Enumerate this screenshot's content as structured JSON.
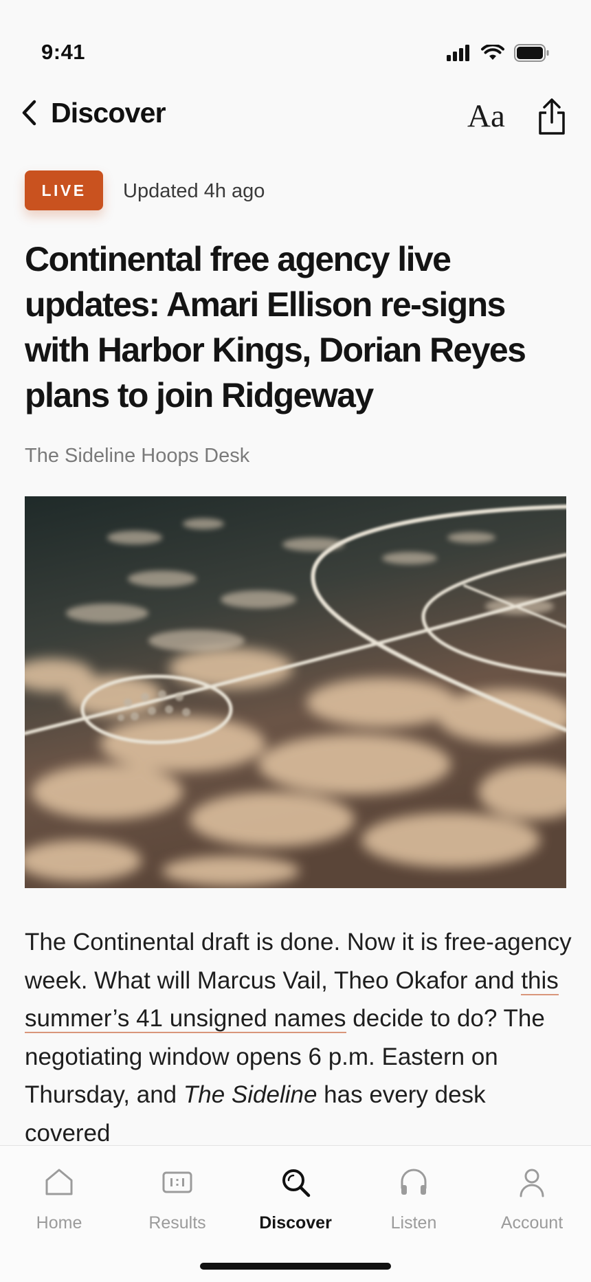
{
  "status_bar": {
    "time": "9:41"
  },
  "nav": {
    "back_label": "Discover",
    "font_button_label": "Aa"
  },
  "article": {
    "live_label": "LIVE",
    "updated": "Updated 4h ago",
    "headline": "Continental free agency live updates: Amari Ellison re-signs with Harbor Kings, Dorian Reyes plans to join Ridgeway",
    "byline": "The Sideline Hoops Desk",
    "body_1": "The Continental draft is done. Now it is free-agency week. What will Marcus Vail, Theo Okafor and ",
    "body_link": "this summer’s 41 unsigned names",
    "body_2": " decide to do? The negotiating window opens 6 p.m. Eastern on Thursday, and ",
    "body_em": "The Sideline",
    "body_3": " has every desk covered"
  },
  "tabs": [
    {
      "label": "Home",
      "icon": "home-icon",
      "active": false
    },
    {
      "label": "Results",
      "icon": "scoreboard-icon",
      "active": false
    },
    {
      "label": "Discover",
      "icon": "search-icon",
      "active": true
    },
    {
      "label": "Listen",
      "icon": "headphones-icon",
      "active": false
    },
    {
      "label": "Account",
      "icon": "person-icon",
      "active": false
    }
  ],
  "colors": {
    "accent": "#c9521f",
    "text": "#141414",
    "muted": "#9b9b9b"
  }
}
